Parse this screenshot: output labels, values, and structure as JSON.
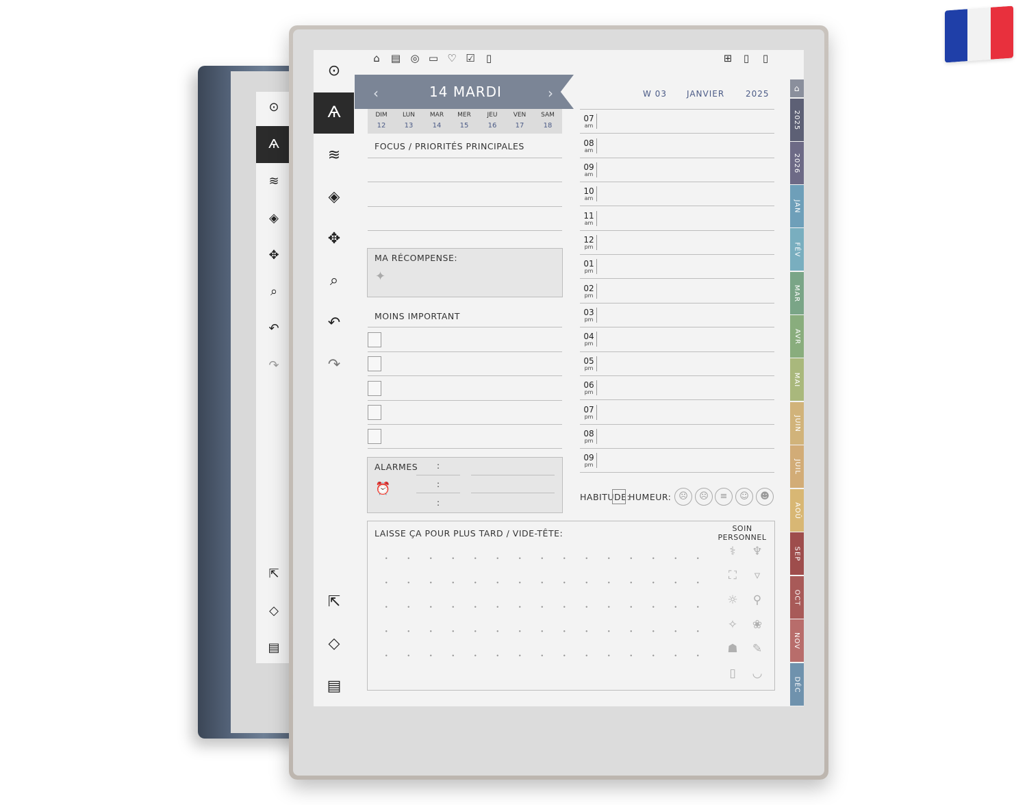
{
  "flag": {
    "colors": [
      "#1f3fa8",
      "#f2f2f2",
      "#e8303d"
    ]
  },
  "colors": {
    "ribbon": "#7b8596",
    "accent_text": "#4a5a86"
  },
  "back_device": {
    "icons": [
      "pen-icon",
      "pen-active-icon",
      "lines-icon",
      "eraser-icon",
      "move-icon",
      "zoom-icon",
      "undo-icon",
      "redo-icon",
      "export-icon",
      "layers-icon",
      "notebook-icon"
    ]
  },
  "toolbar": {
    "icons": [
      "menu-icon",
      "pen-icon",
      "strokes-icon",
      "selection-eraser-icon",
      "move-icon",
      "zoom-icon",
      "undo-icon",
      "redo-icon",
      "export-icon",
      "layers-icon",
      "notebook-icon"
    ]
  },
  "top_icons_left": [
    "home-icon",
    "clipboard-icon",
    "target-icon",
    "wallet-icon",
    "heart-icon",
    "habit-icon",
    "page-icon"
  ],
  "top_icons_right": [
    "grid-icon",
    "page-1-icon",
    "page-2-icon"
  ],
  "header": {
    "day_title": "14 MARDI",
    "week": "W 03",
    "month": "JANVIER",
    "year": "2025"
  },
  "week_days": [
    {
      "name": "DIM",
      "date": "12"
    },
    {
      "name": "LUN",
      "date": "13"
    },
    {
      "name": "MAR",
      "date": "14"
    },
    {
      "name": "MER",
      "date": "15"
    },
    {
      "name": "JEU",
      "date": "16"
    },
    {
      "name": "VEN",
      "date": "17"
    },
    {
      "name": "SAM",
      "date": "18"
    }
  ],
  "sections": {
    "focus": "FOCUS / PRIORITÉS PRINCIPALES",
    "reward": "MA RÉCOMPENSE:",
    "less_important": "MOINS IMPORTANT",
    "alarms": "ALARMES",
    "alarm_sep": ":",
    "brain_dump": "LAISSE ÇA POUR PLUS TARD / VIDE-TÊTE:",
    "self_care_1": "SOIN",
    "self_care_2": "PERSONNEL",
    "habit": "HABITUDE:",
    "mood": "HUMEUR:"
  },
  "hours": [
    {
      "h": "07",
      "p": "am"
    },
    {
      "h": "08",
      "p": "am"
    },
    {
      "h": "09",
      "p": "am"
    },
    {
      "h": "10",
      "p": "am"
    },
    {
      "h": "11",
      "p": "am"
    },
    {
      "h": "12",
      "p": "pm"
    },
    {
      "h": "01",
      "p": "pm"
    },
    {
      "h": "02",
      "p": "pm"
    },
    {
      "h": "03",
      "p": "pm"
    },
    {
      "h": "04",
      "p": "pm"
    },
    {
      "h": "05",
      "p": "pm"
    },
    {
      "h": "06",
      "p": "pm"
    },
    {
      "h": "07",
      "p": "pm"
    },
    {
      "h": "08",
      "p": "pm"
    },
    {
      "h": "09",
      "p": "pm"
    }
  ],
  "moods": [
    "very-sad-face-icon",
    "sad-face-icon",
    "neutral-face-icon",
    "happy-face-icon",
    "very-happy-face-icon"
  ],
  "self_care_icons": [
    "pills-icon",
    "tooth-icon",
    "bath-icon",
    "water-glass-icon",
    "sun-icon",
    "exercise-bike-icon",
    "cleaning-icon",
    "paw-icon",
    "people-icon",
    "journal-icon",
    "phone-icon",
    "meal-icon"
  ],
  "side_tabs": [
    {
      "label": "",
      "color": "#8a8f9c",
      "icon": "home-tab-icon"
    },
    {
      "label": "2025",
      "color": "#5d6075"
    },
    {
      "label": "2026",
      "color": "#6d6a86"
    },
    {
      "label": "JAN",
      "color": "#6e9fb9"
    },
    {
      "label": "FÉV",
      "color": "#79aebf"
    },
    {
      "label": "MAR",
      "color": "#7aa587"
    },
    {
      "label": "AVR",
      "color": "#89ad7d"
    },
    {
      "label": "MAI",
      "color": "#a9b87c"
    },
    {
      "label": "JUIN",
      "color": "#d1b37a"
    },
    {
      "label": "JUIL",
      "color": "#d2ac77"
    },
    {
      "label": "AOÛ",
      "color": "#d8b774"
    },
    {
      "label": "SEP",
      "color": "#9e4d4c"
    },
    {
      "label": "OCT",
      "color": "#a85a58"
    },
    {
      "label": "NOV",
      "color": "#b86d6b"
    },
    {
      "label": "DÉC",
      "color": "#6f92ad"
    }
  ]
}
